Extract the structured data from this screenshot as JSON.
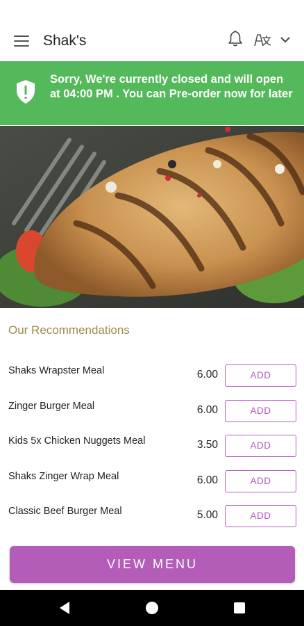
{
  "app": {
    "title": "Shak's"
  },
  "banner": {
    "message": "Sorry, We're currently closed and will open at 04:00 PM . You can Pre-order now for later",
    "icon": "shield-alert-icon",
    "color": "#54b95a"
  },
  "section": {
    "title": "Our Recommendations"
  },
  "recommendations": [
    {
      "name": "Shaks Wrapster Meal",
      "price": "6.00",
      "add_label": "ADD"
    },
    {
      "name": "Zinger Burger Meal",
      "price": "6.00",
      "add_label": "ADD"
    },
    {
      "name": "Kids 5x Chicken Nuggets Meal",
      "price": "3.50",
      "add_label": "ADD"
    },
    {
      "name": "Shaks Zinger Wrap Meal",
      "price": "6.00",
      "add_label": "ADD"
    },
    {
      "name": "Classic Beef Burger Meal",
      "price": "5.00",
      "add_label": "ADD"
    }
  ],
  "view_menu_label": "VIEW MENU",
  "colors": {
    "accent": "#b35cb8",
    "banner": "#54b95a",
    "section_title": "#a08a4a"
  },
  "icons": [
    "menu-icon",
    "bell-icon",
    "language-icon",
    "chevron-down-icon",
    "back-icon",
    "home-icon",
    "recents-icon"
  ]
}
